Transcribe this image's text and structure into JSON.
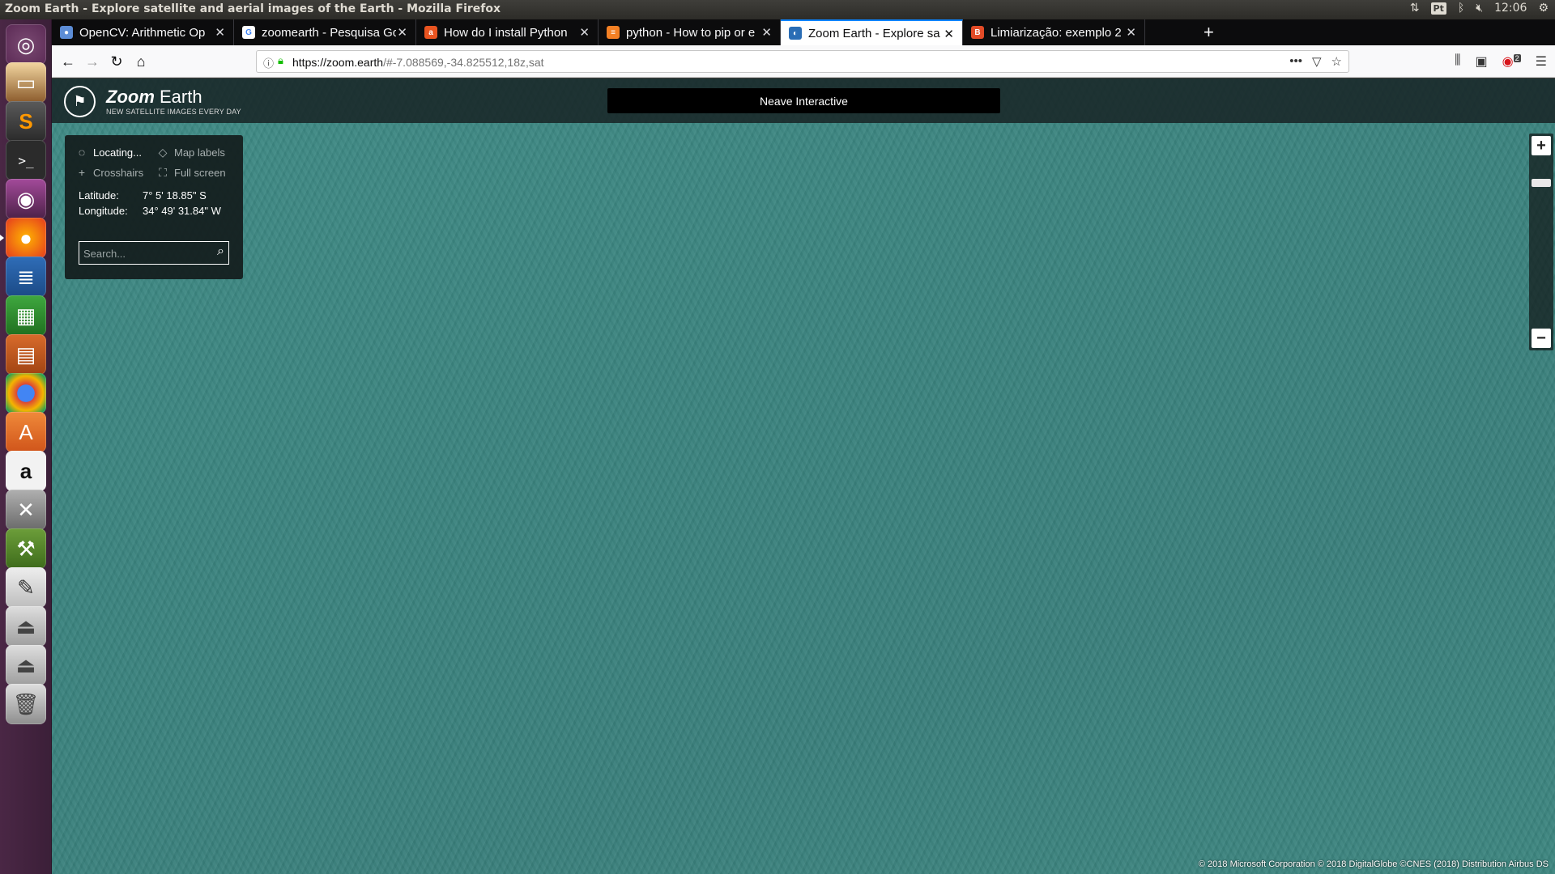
{
  "os": {
    "window_title": "Zoom Earth - Explore satellite and aerial images of the Earth - Mozilla Firefox",
    "keyboard_layout": "Pt",
    "clock": "12:06"
  },
  "browser": {
    "tabs": [
      {
        "label": "OpenCV: Arithmetic Op",
        "favicon": "opencv-icon",
        "color": "#5c8dd6"
      },
      {
        "label": "zoomearth - Pesquisa Go",
        "favicon": "google-icon",
        "color": "#4285f4"
      },
      {
        "label": "How do I install Python",
        "favicon": "askubuntu-icon",
        "color": "#e95420"
      },
      {
        "label": "python - How to pip or e",
        "favicon": "stackoverflow-icon",
        "color": "#f48024"
      },
      {
        "label": "Zoom Earth - Explore sa",
        "favicon": "zoomearth-icon",
        "color": "#2a6db5"
      },
      {
        "label": "Limiarização: exemplo 2",
        "favicon": "blogger-icon",
        "color": "#e34b27"
      }
    ],
    "url_host": "https://zoom.earth",
    "url_rest": "/#-7.088569,-34.825512,18z,sat",
    "notification_badge": "2"
  },
  "zoom_earth": {
    "brand_italic": "Zoom",
    "brand_rest": " Earth",
    "tagline": "NEW SATELLITE IMAGES EVERY DAY",
    "ad_text": "Neave Interactive",
    "locating_label": "Locating...",
    "map_labels_label": "Map labels",
    "crosshairs_label": "Crosshairs",
    "fullscreen_label": "Full screen",
    "latitude_label": "Latitude:",
    "latitude_value": "7° 5' 18.85\" S",
    "longitude_label": "Longitude:",
    "longitude_value": "34° 49' 31.84\" W",
    "search_placeholder": "Search...",
    "zoom_in": "+",
    "zoom_out": "−",
    "attribution": "© 2018 Microsoft Corporation © 2018 DigitalGlobe ©CNES (2018) Distribution Airbus DS"
  }
}
